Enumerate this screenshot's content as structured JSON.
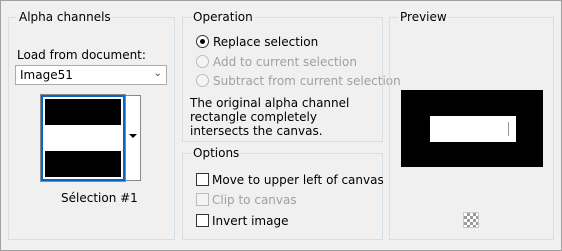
{
  "alpha_group": {
    "title": "Alpha channels",
    "load_label": "Load from document:",
    "document_value": "Image51",
    "selection_name": "Sélection #1"
  },
  "operation_group": {
    "title": "Operation",
    "options": [
      {
        "label": "Replace selection",
        "selected": true,
        "enabled": true
      },
      {
        "label": "Add to current selection",
        "selected": false,
        "enabled": false
      },
      {
        "label": "Subtract from current selection",
        "selected": false,
        "enabled": false
      }
    ],
    "description": "The original alpha channel rectangle completely intersects the canvas."
  },
  "options_group": {
    "title": "Options",
    "checkboxes": [
      {
        "label": "Move to upper left of canvas",
        "checked": false,
        "enabled": true
      },
      {
        "label": "Clip to canvas",
        "checked": false,
        "enabled": false
      },
      {
        "label": "Invert image",
        "checked": false,
        "enabled": true
      }
    ]
  },
  "preview_group": {
    "title": "Preview"
  },
  "colors": {
    "background": "#f0f0f0",
    "group_border": "#d5dfe5",
    "selection_highlight": "#0a64c8",
    "disabled_text": "#a0a0a0"
  }
}
